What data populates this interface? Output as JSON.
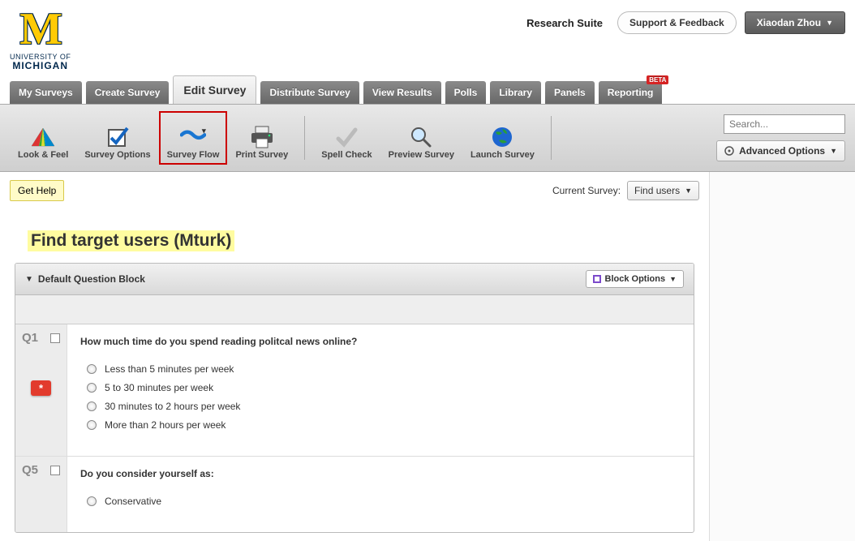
{
  "header": {
    "logo_university": "UNIVERSITY OF",
    "logo_school": "MICHIGAN",
    "research_suite": "Research Suite",
    "support_feedback": "Support & Feedback",
    "user_name": "Xiaodan Zhou"
  },
  "tabs": {
    "my_surveys": "My Surveys",
    "create_survey": "Create Survey",
    "edit_survey": "Edit Survey",
    "distribute_survey": "Distribute Survey",
    "view_results": "View Results",
    "polls": "Polls",
    "library": "Library",
    "panels": "Panels",
    "reporting": "Reporting",
    "beta": "BETA"
  },
  "toolbar": {
    "look_feel": "Look & Feel",
    "survey_options": "Survey Options",
    "survey_flow": "Survey Flow",
    "print_survey": "Print Survey",
    "spell_check": "Spell Check",
    "preview_survey": "Preview Survey",
    "launch_survey": "Launch Survey",
    "search_placeholder": "Search...",
    "advanced_options": "Advanced Options"
  },
  "subheader": {
    "get_help": "Get Help",
    "current_survey_label": "Current Survey:",
    "current_survey_value": "Find users"
  },
  "survey": {
    "title": "Find target users (Mturk)"
  },
  "block": {
    "title": "Default Question Block",
    "options_label": "Block Options"
  },
  "questions": [
    {
      "id": "Q1",
      "required": true,
      "text": "How much time do you spend reading politcal news online?",
      "options": [
        "Less than 5 minutes per week",
        "5 to 30 minutes per week",
        "30 minutes to 2 hours per week",
        "More than 2 hours per week"
      ]
    },
    {
      "id": "Q5",
      "required": false,
      "text": "Do you consider yourself as:",
      "options": [
        "Conservative"
      ]
    }
  ]
}
